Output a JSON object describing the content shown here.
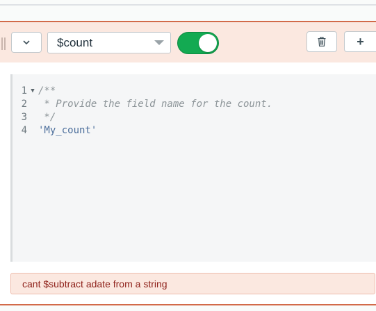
{
  "stage": {
    "operator": "$count",
    "enabled": true,
    "collapse_icon": "chevron-down-icon",
    "delete_icon": "trash-icon",
    "add_label": "+"
  },
  "editor": {
    "lines": [
      {
        "number": "1",
        "text": "/**",
        "kind": "comment",
        "foldable": true
      },
      {
        "number": "2",
        "text": " * Provide the field name for the count.",
        "kind": "comment",
        "foldable": false
      },
      {
        "number": "3",
        "text": " */",
        "kind": "comment",
        "foldable": false
      },
      {
        "number": "4",
        "text": "'My_count'",
        "kind": "string",
        "foldable": false
      }
    ]
  },
  "error": {
    "message": "cant $subtract adate from a string"
  },
  "colors": {
    "accent_green": "#13aa52",
    "stage_border": "#d26a49",
    "error_text": "#8f221b"
  }
}
